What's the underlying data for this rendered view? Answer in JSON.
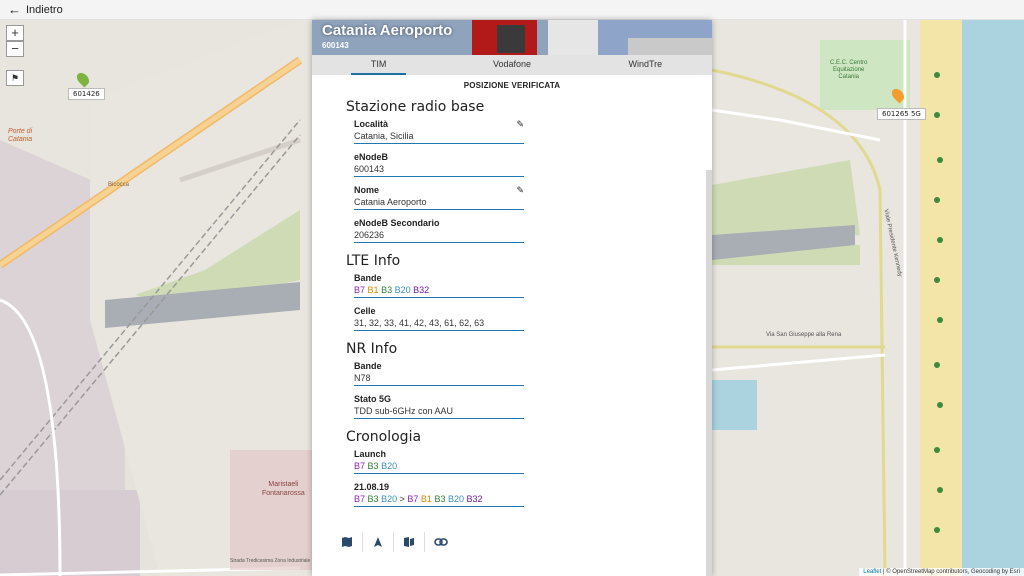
{
  "topbar": {
    "back_label": "Indietro"
  },
  "map": {
    "zoom_in": "+",
    "zoom_out": "−",
    "markers": [
      "601426",
      "601265 5G"
    ],
    "labels": {
      "porta_line1": "Porte di",
      "porta_line2": "Catania",
      "bicocca": "Bicocca",
      "cec_line1": "C.E.C. Centro",
      "cec_line2": "Equitazione",
      "cec_line3": "Catania",
      "maristaeli_line1": "Maristaeli",
      "maristaeli_line2": "Fontanarossa",
      "via_san_giuseppe": "Via San Giuseppe alla Rena",
      "viale_kennedy": "Viale Presidente Kennedy",
      "strada_tredicesima": "Strada Tredicesima Zona Industriale"
    },
    "attribution": {
      "leaflet": "Leaflet",
      "rest": "| © OpenStreetMap contributors, Geocoding by Esri"
    }
  },
  "panel": {
    "title": "Catania Aeroporto",
    "subtitle": "600143",
    "tabs": [
      "TIM",
      "Vodafone",
      "WindTre"
    ],
    "status": "POSIZIONE VERIFICATA",
    "sections": {
      "srb": {
        "title": "Stazione radio base",
        "localita": {
          "label": "Località",
          "value": "Catania, Sicilia"
        },
        "enodeb": {
          "label": "eNodeB",
          "value": "600143"
        },
        "nome": {
          "label": "Nome",
          "value": "Catania Aeroporto"
        },
        "enodeb2": {
          "label": "eNodeB Secondario",
          "value": "206236"
        }
      },
      "lte": {
        "title": "LTE Info",
        "bande": {
          "label": "Bande",
          "values": [
            "B7",
            "B1",
            "B3",
            "B20",
            "B32"
          ]
        },
        "celle": {
          "label": "Celle",
          "value": "31, 32, 33, 41, 42, 43, 61, 62, 63"
        }
      },
      "nr": {
        "title": "NR Info",
        "bande": {
          "label": "Bande",
          "value": "N78"
        },
        "stato": {
          "label": "Stato 5G",
          "value": "TDD sub-6GHz con AAU"
        }
      },
      "cron": {
        "title": "Cronologia",
        "launch": {
          "label": "Launch",
          "values": [
            "B7",
            "B3",
            "B20"
          ]
        },
        "update": {
          "label": "21.08.19",
          "before": [
            "B7",
            "B3",
            "B20"
          ],
          "arrow": ">",
          "after": [
            "B7",
            "B1",
            "B3",
            "B20",
            "B32"
          ]
        }
      }
    }
  },
  "colors": {
    "accent": "#2377b3",
    "B7": "#8e24aa",
    "B1": "#d08b00",
    "B3": "#2e7d32",
    "B20": "#3a8fb7",
    "B32": "#6a1b9a",
    "N78": "#c2410c"
  },
  "icons": [
    "back-arrow-icon",
    "edit-icon",
    "map-icon",
    "navigate-icon",
    "directions-icon",
    "link-icon",
    "antenna-marker-icon"
  ]
}
